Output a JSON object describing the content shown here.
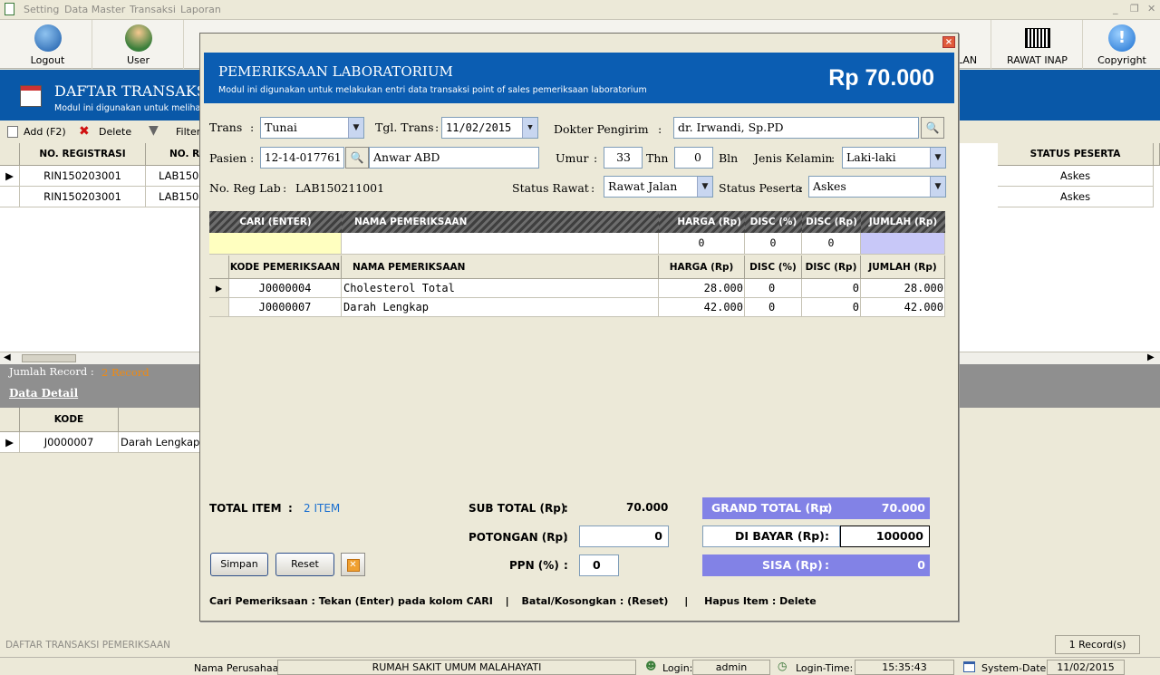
{
  "menu": {
    "items": [
      "Setting",
      "Data Master",
      "Transaksi",
      "Laporan"
    ]
  },
  "toolbar": {
    "buttons": [
      {
        "label": "Logout",
        "icon": "logout-icon"
      },
      {
        "label": "User",
        "icon": "user-icon"
      },
      {
        "label": "RAWAT INAP",
        "icon": "barcode-icon"
      },
      {
        "label": "Copyright",
        "icon": "info-icon"
      }
    ],
    "partial_label": "LAN"
  },
  "page": {
    "title": "DAFTAR TRANSAKSI",
    "subtitle": "Modul ini digunakan untuk meliha",
    "actions": {
      "add": "Add (F2)",
      "delete": "Delete",
      "filter": "Filter"
    }
  },
  "list": {
    "columns": [
      "NO. REGISTRASI",
      "NO. R",
      "STATUS PESERTA"
    ],
    "rows": [
      {
        "reg": "RIN150203001",
        "lab": "LAB150",
        "status": "Askes"
      },
      {
        "reg": "RIN150203001",
        "lab": "LAB150",
        "status": "Askes"
      }
    ]
  },
  "record_summary": {
    "label": "Jumlah Record :",
    "value": "2 Record"
  },
  "detail": {
    "title": "Data Detail",
    "columns": [
      "KODE"
    ],
    "rows": [
      {
        "kode": "J0000007",
        "nama": "Darah Lengkap"
      }
    ]
  },
  "status_left": "DAFTAR TRANSAKSI PEMERIKSAAN",
  "record_count": "1 Record(s)",
  "statusbar": {
    "company_label": "Nama Perusahaan",
    "company": "RUMAH SAKIT UMUM MALAHAYATI",
    "login_label": "Login:",
    "login": "admin",
    "login_time_label": "Login-Time:",
    "login_time": "15:35:43",
    "system_date_label": "System-Date:",
    "system_date": "11/02/2015"
  },
  "modal": {
    "title": "PEMERIKSAAN LABORATORIUM",
    "subtitle": "Modul ini digunakan untuk melakukan entri data transaksi point of sales pemeriksaan laboratorium",
    "total_amount": "Rp 70.000",
    "form": {
      "trans_label": "Trans",
      "trans": "Tunai",
      "tgl_label": "Tgl. Trans",
      "tgl": "11/02/2015",
      "dokter_label": "Dokter Pengirim",
      "dokter": "dr. Irwandi, Sp.PD",
      "pasien_label": "Pasien",
      "pasien_id": "12-14-017761",
      "pasien_nama": "Anwar ABD",
      "umur_label": "Umur",
      "umur_thn": "33",
      "thn_label": "Thn",
      "umur_bln": "0",
      "bln_label": "Bln",
      "jk_label": "Jenis Kelamin",
      "jk": "Laki-laki",
      "noreg_label": "No. Reg Lab",
      "noreg": "LAB150211001",
      "status_rawat_label": "Status Rawat",
      "status_rawat": "Rawat Jalan",
      "status_peserta_label": "Status Peserta",
      "status_peserta": "Askes"
    },
    "search_grid": {
      "headers": [
        "CARI  (ENTER)",
        "NAMA PEMERIKSAAN",
        "HARGA (Rp)",
        "DISC (%)",
        "DISC (Rp)",
        "JUMLAH (Rp)"
      ],
      "values": [
        "",
        "",
        "0",
        "0",
        "0",
        ""
      ]
    },
    "items": {
      "headers": [
        "KODE PEMERIKSAAN",
        "NAMA PEMERIKSAAN",
        "HARGA (Rp)",
        "DISC (%)",
        "DISC (Rp)",
        "JUMLAH (Rp)"
      ],
      "rows": [
        {
          "kode": "J0000004",
          "nama": "Cholesterol Total",
          "harga": "28.000",
          "disc_pct": "0",
          "disc_rp": "0",
          "jumlah": "28.000"
        },
        {
          "kode": "J0000007",
          "nama": "Darah Lengkap",
          "harga": "42.000",
          "disc_pct": "0",
          "disc_rp": "0",
          "jumlah": "42.000"
        }
      ]
    },
    "summary": {
      "total_item_label": "TOTAL ITEM",
      "total_item": "2 ITEM",
      "subtotal_label": "SUB TOTAL (Rp)",
      "subtotal": "70.000",
      "potongan_label": "POTONGAN (Rp)",
      "potongan": "0",
      "ppn_label": "PPN (%)",
      "ppn": "0",
      "grand_total_label": "GRAND TOTAL (Rp)",
      "grand_total": "70.000",
      "dibayar_label": "DI BAYAR (Rp)",
      "dibayar": "100000",
      "sisa_label": "SISA (Rp)",
      "sisa": "0"
    },
    "buttons": {
      "save": "Simpan",
      "reset": "Reset"
    },
    "help": {
      "cari": "Cari Pemeriksaan : Tekan (Enter) pada kolom CARI",
      "batal": "Batal/Kosongkan : (Reset)",
      "hapus": "Hapus Item : Delete"
    }
  }
}
